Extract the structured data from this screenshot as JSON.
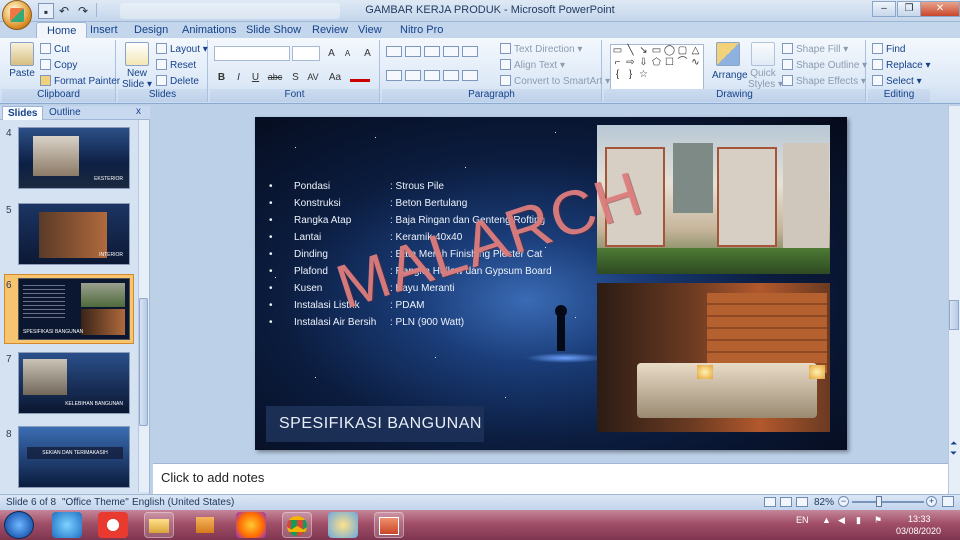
{
  "window": {
    "title": "GAMBAR KERJA PRODUK - Microsoft PowerPoint",
    "minimize": "–",
    "restore": "❐",
    "close": "✕"
  },
  "quick_access": {
    "save": "save-icon",
    "undo": "undo-icon",
    "redo": "redo-icon"
  },
  "tabs": [
    {
      "label": "Home",
      "active": true
    },
    {
      "label": "Insert"
    },
    {
      "label": "Design"
    },
    {
      "label": "Animations"
    },
    {
      "label": "Slide Show"
    },
    {
      "label": "Review"
    },
    {
      "label": "View"
    },
    {
      "label": "Nitro Pro"
    }
  ],
  "ribbon": {
    "clipboard": {
      "label": "Clipboard",
      "paste": "Paste",
      "cut": "Cut",
      "copy": "Copy",
      "format_painter": "Format Painter"
    },
    "slides": {
      "label": "Slides",
      "new_slide": "New",
      "new_slide_2": "Slide ▾",
      "layout": "Layout ▾",
      "reset": "Reset",
      "delete": "Delete"
    },
    "font": {
      "label": "Font",
      "bold": "B",
      "italic": "I",
      "underline": "U",
      "strike": "abc",
      "shadow": "S",
      "spacing": "AV",
      "case": "Aa",
      "grow": "A",
      "shrink": "A",
      "clear": "A"
    },
    "paragraph": {
      "label": "Paragraph",
      "text_direction": "Text Direction ▾",
      "align_text": "Align Text ▾",
      "smartart": "Convert to SmartArt ▾"
    },
    "drawing": {
      "label": "Drawing",
      "arrange": "Arrange",
      "quick_styles": "Quick",
      "quick_styles_2": "Styles ▾",
      "shape_fill": "Shape Fill ▾",
      "shape_outline": "Shape Outline ▾",
      "shape_effects": "Shape Effects ▾"
    },
    "editing": {
      "label": "Editing",
      "find": "Find",
      "replace": "Replace ▾",
      "select": "Select ▾"
    }
  },
  "pane": {
    "tabs": [
      "Slides",
      "Outline"
    ],
    "close": "x",
    "thumbnails": [
      {
        "num": "4",
        "caption": "EKSTERIOR"
      },
      {
        "num": "5",
        "caption": "INTERIOR"
      },
      {
        "num": "6",
        "caption": "SPESIFIKASI BANGUNAN",
        "selected": true
      },
      {
        "num": "7",
        "caption": "KELEBIHAN BANGUNAN"
      },
      {
        "num": "8",
        "caption": "SEKIAN DAN TERIMAKASIH"
      }
    ]
  },
  "slide": {
    "watermark": "MALARCH",
    "title": "SPESIFIKASI BANGUNAN",
    "specs": [
      {
        "bullet": "•",
        "key": "Pondasi",
        "value": ": Strous Pile"
      },
      {
        "bullet": "•",
        "key": "Konstruksi",
        "value": ": Beton Bertulang"
      },
      {
        "bullet": "•",
        "key": "Rangka Atap",
        "value": ": Baja Ringan dan Genteng Rofting"
      },
      {
        "bullet": "•",
        "key": "Lantai",
        "value": ": Keramik 40x40"
      },
      {
        "bullet": "•",
        "key": "Dinding",
        "value": ": Bata Merah Finishing Plester Cat"
      },
      {
        "bullet": "•",
        "key": "Plafond",
        "value": ": Rangka Hollow dan Gypsum Board"
      },
      {
        "bullet": "•",
        "key": "Kusen",
        "value": ": Kayu Meranti"
      },
      {
        "bullet": "•",
        "key": "Instalasi Listrik",
        "value": ": PDAM"
      },
      {
        "bullet": "•",
        "key": "Instalasi Air Bersih",
        "value": ": PLN (900  Watt)"
      }
    ]
  },
  "notes": {
    "placeholder": "Click to add notes"
  },
  "status": {
    "slide": "Slide 6 of 8",
    "theme": "\"Office Theme\"",
    "language": "English (United States)",
    "zoom": "82%"
  },
  "taskbar": {
    "language": "EN",
    "time": "13:33",
    "date": "03/08/2020"
  },
  "colors": {
    "accent": "#15428b",
    "selection": "#f7c470",
    "watermark": "#e08080"
  }
}
